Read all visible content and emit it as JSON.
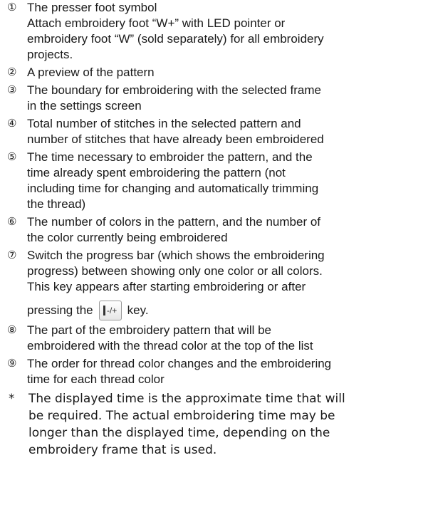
{
  "items": [
    {
      "num": "①",
      "lines": [
        "The presser foot symbol",
        "Attach embroidery foot “W+” with LED pointer or",
        "embroidery foot “W” (sold separately) for all embroidery",
        "projects."
      ]
    },
    {
      "num": "②",
      "lines": [
        "A preview of the pattern"
      ]
    },
    {
      "num": "③",
      "lines": [
        "The boundary for embroidering with the selected frame",
        "in the settings screen"
      ]
    },
    {
      "num": "④",
      "lines": [
        "Total number of stitches in the selected pattern and",
        "number of stitches that have already been embroidered"
      ]
    },
    {
      "num": "⑤",
      "lines": [
        "The time necessary to embroider the pattern, and the",
        "time already spent embroidering the pattern (not",
        "including time for changing and automatically trimming",
        "the thread)"
      ]
    },
    {
      "num": "⑥",
      "lines": [
        "The number of colors in the pattern, and the number of",
        "the color currently being embroidered"
      ]
    },
    {
      "num": "⑦",
      "lines": [
        "Switch the progress bar (which shows the embroidering",
        "progress) between showing only one color or all colors.",
        "This key appears after starting embroidering or after"
      ],
      "key_before": "pressing the",
      "key_label": "-/+",
      "key_after": "key."
    },
    {
      "num": "⑧",
      "lines": [
        "The part of the embroidery pattern that will be",
        "embroidered with the thread color at the top of the list"
      ]
    },
    {
      "num": "⑨",
      "lines": [
        "The order for thread color changes and the embroidering",
        "time for each thread color"
      ]
    }
  ],
  "note": {
    "marker": "*",
    "lines": [
      "The displayed time is the approximate time that will",
      "be required. The actual embroidering time may be",
      "longer than the displayed time, depending on the",
      "embroidery frame that is used."
    ]
  },
  "icons": {
    "key": "needle-plus-minus-icon"
  }
}
